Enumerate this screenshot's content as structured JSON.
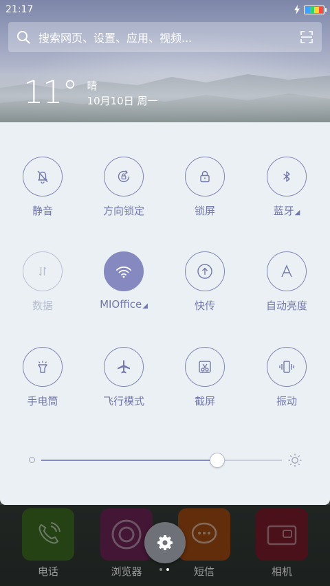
{
  "status_bar": {
    "time": "21:17"
  },
  "search": {
    "placeholder": "搜索网页、设置、应用、视频..."
  },
  "weather": {
    "temperature": "11°",
    "condition": "晴",
    "date": "10月10日 周一"
  },
  "toggles": [
    {
      "id": "mute",
      "label": "静音",
      "state": "off",
      "icon": "bell-off-icon"
    },
    {
      "id": "rotation-lock",
      "label": "方向锁定",
      "state": "off",
      "icon": "rotation-lock-icon"
    },
    {
      "id": "lock-screen",
      "label": "锁屏",
      "state": "off",
      "icon": "lock-icon"
    },
    {
      "id": "bluetooth",
      "label": "蓝牙",
      "state": "off",
      "icon": "bluetooth-icon",
      "has_menu": true
    },
    {
      "id": "mobile-data",
      "label": "数据",
      "state": "disabled",
      "icon": "data-arrows-icon"
    },
    {
      "id": "wifi",
      "label": "MIOffice",
      "state": "on",
      "icon": "wifi-icon",
      "has_menu": true
    },
    {
      "id": "quick-transfer",
      "label": "快传",
      "state": "off",
      "icon": "upload-icon"
    },
    {
      "id": "auto-brightness",
      "label": "自动亮度",
      "state": "off",
      "icon": "letter-a-icon"
    },
    {
      "id": "flashlight",
      "label": "手电筒",
      "state": "off",
      "icon": "flashlight-icon"
    },
    {
      "id": "airplane",
      "label": "飞行模式",
      "state": "off",
      "icon": "airplane-icon"
    },
    {
      "id": "screenshot",
      "label": "截屏",
      "state": "off",
      "icon": "scissors-icon"
    },
    {
      "id": "vibrate",
      "label": "振动",
      "state": "off",
      "icon": "vibrate-icon"
    }
  ],
  "brightness": {
    "level": 0.73
  },
  "dock": [
    {
      "label": "电话",
      "icon": "phone-icon",
      "color": "#3b6b1f"
    },
    {
      "label": "浏览器",
      "icon": "browser-icon",
      "color": "#6b2455"
    },
    {
      "label": "短信",
      "icon": "message-icon",
      "color": "#9e4a12"
    },
    {
      "label": "相机",
      "icon": "camera-icon",
      "color": "#7a1c2a"
    }
  ],
  "colors": {
    "accent": "#8589c0",
    "panel_bg": "#eaf0f3",
    "label": "#7478ad"
  }
}
